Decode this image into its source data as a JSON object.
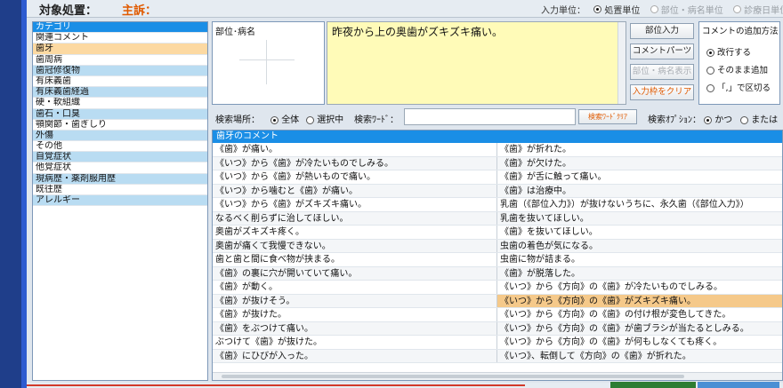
{
  "header": {
    "title_label": "対象処置：",
    "title_value": "主訴：",
    "input_unit_label": "入力単位：",
    "input_units": [
      {
        "label": "処置単位",
        "selected": true
      },
      {
        "label": "部位・病名単位",
        "selected": false
      },
      {
        "label": "診療日単位",
        "selected": false
      }
    ]
  },
  "categories": [
    {
      "label": "カテゴリ",
      "style": "header"
    },
    {
      "label": "関連コメント",
      "style": "plain"
    },
    {
      "label": "歯牙",
      "style": "selected"
    },
    {
      "label": "歯周病",
      "style": "plain"
    },
    {
      "label": "歯冠修復物",
      "style": "blue"
    },
    {
      "label": "有床義歯",
      "style": "plain"
    },
    {
      "label": "有床義歯経過",
      "style": "blue"
    },
    {
      "label": "硬・軟組織",
      "style": "plain"
    },
    {
      "label": "歯石・口臭",
      "style": "blue"
    },
    {
      "label": "顎関節・歯ぎしり",
      "style": "plain"
    },
    {
      "label": "外傷",
      "style": "blue"
    },
    {
      "label": "その他",
      "style": "plain"
    },
    {
      "label": "自覚症状",
      "style": "blue"
    },
    {
      "label": "他覚症状",
      "style": "plain"
    },
    {
      "label": "現病歴・薬剤服用歴",
      "style": "blue"
    },
    {
      "label": "既往歴",
      "style": "plain"
    },
    {
      "label": "アレルギー",
      "style": "blue"
    }
  ],
  "body_panel": {
    "label": "部位･病名"
  },
  "comment_text": "昨夜から上の奥歯がズキズキ痛い。",
  "buttons": {
    "site_input": "部位入力",
    "comment_parts": "コメントパーツ",
    "site_display": "部位・病名表示",
    "clear_input": "入力枠をクリア"
  },
  "append_method": {
    "title": "コメントの追加方法",
    "options": [
      {
        "label": "改行する",
        "selected": true
      },
      {
        "label": "そのまま追加",
        "selected": false
      },
      {
        "label": "「,」で区切る",
        "selected": false
      }
    ]
  },
  "search": {
    "place_label": "検索場所：",
    "place_options": [
      {
        "label": "全体",
        "selected": true
      },
      {
        "label": "選択中",
        "selected": false
      }
    ],
    "keyword_label": "検索ﾜｰﾄﾞ：",
    "keyword_value": "",
    "clear_button": "検索ﾜｰﾄﾞｸﾘｱ",
    "option_label": "検索ｵﾌﾟｼｮﾝ：",
    "option_choices": [
      {
        "label": "かつ",
        "selected": true
      },
      {
        "label": "または",
        "selected": false
      }
    ]
  },
  "table": {
    "header": "歯牙のコメント",
    "rows": [
      [
        "《歯》が痛い。",
        "《歯》が折れた。"
      ],
      [
        "《いつ》から《歯》が冷たいものでしみる。",
        "《歯》が欠けた。"
      ],
      [
        "《いつ》から《歯》が熱いもので痛い。",
        "《歯》が舌に触って痛い。"
      ],
      [
        "《いつ》から噛むと《歯》が痛い。",
        "《歯》は治療中。"
      ],
      [
        "《いつ》から《歯》がズキズキ痛い。",
        "乳歯（《部位入力》）が抜けないうちに、永久歯（《部位入力》）"
      ],
      [
        "なるべく削らずに治してほしい。",
        "乳歯を抜いてほしい。"
      ],
      [
        "奥歯がズキズキ疼く。",
        "《歯》を抜いてほしい。"
      ],
      [
        "奥歯が痛くて我慢できない。",
        "虫歯の着色が気になる。"
      ],
      [
        "歯と歯と間に食べ物が挟まる。",
        "虫歯に物が詰まる。"
      ],
      [
        "《歯》の裏に穴が開いていて痛い。",
        "《歯》が脱落した。"
      ],
      [
        "《歯》が動く。",
        "《いつ》から《方向》の《歯》が冷たいものでしみる。"
      ],
      [
        "《歯》が抜けそう。",
        "《いつ》から《方向》の《歯》がズキズキ痛い。"
      ],
      [
        "《歯》が抜けた。",
        "《いつ》から《方向》の《歯》の付け根が変色してきた。"
      ],
      [
        "《歯》をぶつけて痛い。",
        "《いつ》から《方向》の《歯》が歯ブラシが当たるとしみる。"
      ],
      [
        "ぶつけて《歯》が抜けた。",
        "《いつ》から《方向》の《歯》が何もしなくても疼く。"
      ],
      [
        "《歯》にひびが入った。",
        "《いつ》、転倒して《方向》の《歯》が折れた。"
      ]
    ],
    "highlight": {
      "row": 11,
      "col": 1
    }
  }
}
